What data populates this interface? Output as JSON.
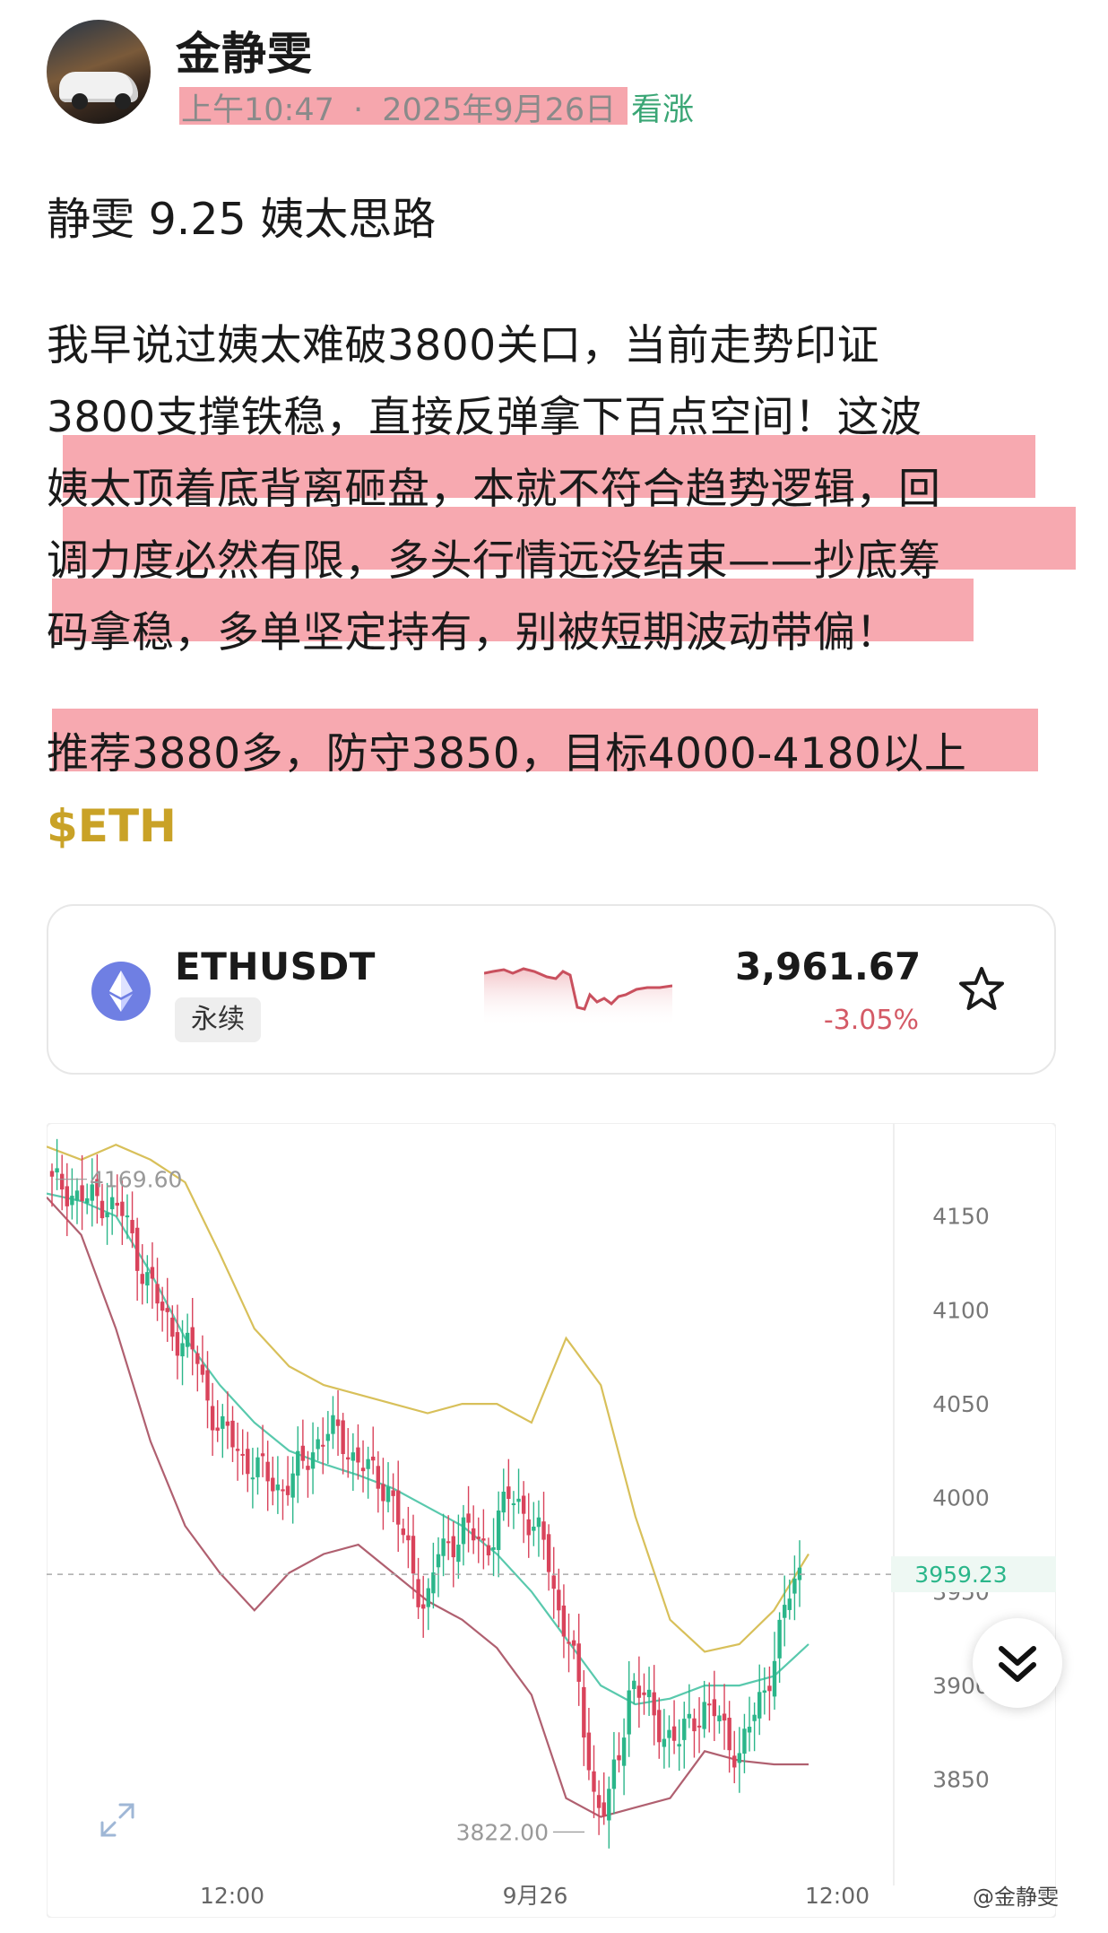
{
  "post": {
    "author": "金静雯",
    "time": "上午10:47",
    "date": "2025年9月26日",
    "separator": "·",
    "sentiment": "看涨",
    "title": "静雯 9.25 姨太思路",
    "body_lines": [
      "我早说过姨太难破3800关口，当前走势印证",
      "3800支撑铁稳，直接反弹拿下百点空间！这波",
      "姨太顶着底背离砸盘，本就不符合趋势逻辑，回",
      "调力度必然有限，多头行情远没结束——抄底筹",
      "码拿稳，多单坚定持有，别被短期波动带偏！"
    ],
    "recommend_line": "推荐3880多，防守3850，目标4000-4180以上",
    "tag": "$ETH"
  },
  "ticker": {
    "icon": "ethereum-icon",
    "symbol": "ETHUSDT",
    "contract_type": "永续",
    "price": "3,961.67",
    "change": "-3.05%",
    "change_color": "#d45a66",
    "favorite_icon": "star-outline-icon"
  },
  "chart_data": {
    "type": "candlestick",
    "y_ticks": [
      "4150",
      "4100",
      "4050",
      "4000",
      "3950",
      "3900",
      "3850"
    ],
    "y_range": [
      3815,
      4190
    ],
    "x_labels": [
      "12:00",
      "9月26",
      "12:00"
    ],
    "current_price_label": "3959.23",
    "high_label": "4169.60",
    "low_label": "3822.00",
    "overlays": [
      "bollinger-upper",
      "bollinger-middle",
      "bollinger-lower"
    ],
    "colors": {
      "up": "#2bb68a",
      "down": "#d9435b",
      "upper": "#d8c05a",
      "middle": "#59c9ad",
      "lower": "#b06070"
    },
    "close_path": [
      4166,
      4167,
      4160,
      4158,
      4160,
      4155,
      4150,
      4130,
      4115,
      4100,
      4090,
      4080,
      4075,
      4050,
      4035,
      4030,
      4020,
      4015,
      4010,
      4005,
      4010,
      4020,
      4030,
      4035,
      4032,
      4022,
      4015,
      4010,
      4005,
      3980,
      3960,
      3940,
      3970,
      3975,
      3985,
      3978,
      3972,
      3990,
      4000,
      3995,
      3985,
      3970,
      3940,
      3925,
      3880,
      3840,
      3835,
      3860,
      3905,
      3895,
      3880,
      3875,
      3870,
      3880,
      3890,
      3885,
      3870,
      3865,
      3880,
      3895,
      3920,
      3945,
      3960
    ],
    "bollinger_upper": [
      4187,
      4180,
      4188,
      4180,
      4168,
      4130,
      4090,
      4070,
      4060,
      4055,
      4050,
      4045,
      4050,
      4050,
      4040,
      4085,
      4060,
      3990,
      3935,
      3918,
      3922,
      3940,
      3970
    ],
    "bollinger_middle": [
      4162,
      4158,
      4150,
      4120,
      4085,
      4060,
      4040,
      4025,
      4018,
      4012,
      4005,
      3995,
      3985,
      3970,
      3950,
      3925,
      3900,
      3890,
      3893,
      3900,
      3900,
      3905,
      3922
    ],
    "bollinger_lower": [
      4160,
      4140,
      4090,
      4030,
      3985,
      3960,
      3940,
      3960,
      3970,
      3975,
      3960,
      3945,
      3935,
      3920,
      3895,
      3840,
      3830,
      3835,
      3840,
      3865,
      3860,
      3858,
      3858
    ]
  },
  "watermark": "@金静雯"
}
